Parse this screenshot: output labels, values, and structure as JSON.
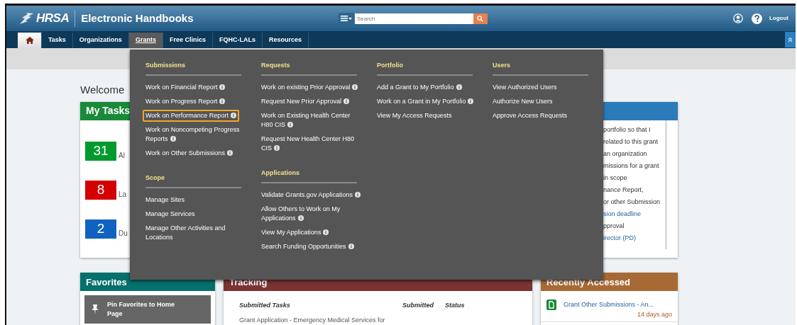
{
  "header": {
    "logo": "HRSA",
    "title": "Electronic Handbooks",
    "search": {
      "placeholder": "Search"
    },
    "logout": "Logout"
  },
  "nav": [
    {
      "kind": "home",
      "selected": false
    },
    {
      "kind": "text",
      "label": "Tasks",
      "selected": false
    },
    {
      "kind": "text",
      "label": "Organizations",
      "selected": false
    },
    {
      "kind": "text",
      "label": "Grants",
      "selected": true
    },
    {
      "kind": "text",
      "label": "Free Clinics",
      "selected": false
    },
    {
      "kind": "text",
      "label": "FQHC-LALs",
      "selected": false
    },
    {
      "kind": "text",
      "label": "Resources",
      "selected": false
    }
  ],
  "welcome": "Welcome",
  "my_tasks": {
    "title": "My Tasks",
    "items": [
      {
        "count": "31",
        "label": "Al",
        "color": "#009a2e"
      },
      {
        "count": "8",
        "label": "La",
        "color": "#d40000"
      },
      {
        "count": "2",
        "label": "Du",
        "color": "#1062c0"
      }
    ]
  },
  "help_card": {
    "lines": [
      {
        "text": "portfolio so that I",
        "link": false
      },
      {
        "text": "related to this grant",
        "link": false
      },
      {
        "text": "an organization",
        "link": false
      },
      {
        "text": "missions for a grant",
        "link": false
      },
      {
        "text": "in scope",
        "link": false
      },
      {
        "text": "nance Report,",
        "link": false
      },
      {
        "text": "or other Submission",
        "link": false
      },
      {
        "text": "sion deadline",
        "link": true
      },
      {
        "text": "pproval",
        "link": false
      },
      {
        "text": "irector (PD)",
        "link": true
      }
    ]
  },
  "favorites": {
    "title": "Favorites",
    "button": "Pin Favorites to Home Page"
  },
  "tracking": {
    "title": "Tracking",
    "columns": [
      "Submitted Tasks",
      "Submitted",
      "Status"
    ],
    "row": "Grant Application - Emergency Medical Services for"
  },
  "recent": {
    "title": "Recently Accessed",
    "items": [
      {
        "name": "Grant Other Submissions - An...",
        "time": "14 days ago"
      }
    ]
  },
  "menu": {
    "columns": [
      {
        "sections": [
          {
            "heading": "Submissions",
            "items": [
              {
                "label": "Work on Financial Report",
                "info": true,
                "highlighted": false
              },
              {
                "label": "Work on Progress Report",
                "info": true,
                "highlighted": false
              },
              {
                "label": "Work on Performance Report",
                "info": true,
                "highlighted": true
              },
              {
                "label": "Work on Noncompeting Progress Reports",
                "info": true,
                "highlighted": false
              },
              {
                "label": "Work on Other Submissions",
                "info": true,
                "highlighted": false
              }
            ]
          },
          {
            "heading": "Scope",
            "items": [
              {
                "label": "Manage Sites",
                "info": false,
                "highlighted": false
              },
              {
                "label": "Manage Services",
                "info": false,
                "highlighted": false
              },
              {
                "label": "Manage Other Activities and Locations",
                "info": false,
                "highlighted": false
              }
            ]
          }
        ]
      },
      {
        "sections": [
          {
            "heading": "Requests",
            "items": [
              {
                "label": "Work on existing Prior Approval",
                "info": true,
                "highlighted": false
              },
              {
                "label": "Request New Prior Approval",
                "info": true,
                "highlighted": false
              },
              {
                "label": "Work on Existing Health Center H80 CIS",
                "info": true,
                "highlighted": false
              },
              {
                "label": "Request New Health Center H80 CIS",
                "info": true,
                "highlighted": false
              }
            ]
          },
          {
            "heading": "Applications",
            "items": [
              {
                "label": "Validate Grants.gov Applications",
                "info": true,
                "highlighted": false
              },
              {
                "label": "Allow Others to Work on My Applications",
                "info": true,
                "highlighted": false
              },
              {
                "label": "View My Applications",
                "info": true,
                "highlighted": false
              },
              {
                "label": "Search Funding Opportunities",
                "info": true,
                "highlighted": false
              }
            ]
          }
        ]
      },
      {
        "sections": [
          {
            "heading": "Portfolio",
            "items": [
              {
                "label": "Add a Grant to My Portfolio",
                "info": true,
                "highlighted": false
              },
              {
                "label": "Work on a Grant in My Portfolio",
                "info": true,
                "highlighted": false
              },
              {
                "label": "View My Access Requests",
                "info": false,
                "highlighted": false
              }
            ]
          }
        ]
      },
      {
        "sections": [
          {
            "heading": "Users",
            "items": [
              {
                "label": "View Authorized Users",
                "info": false,
                "highlighted": false
              },
              {
                "label": "Authorize New Users",
                "info": false,
                "highlighted": false
              },
              {
                "label": "Approve Access Requests",
                "info": false,
                "highlighted": false
              }
            ]
          }
        ]
      }
    ]
  }
}
